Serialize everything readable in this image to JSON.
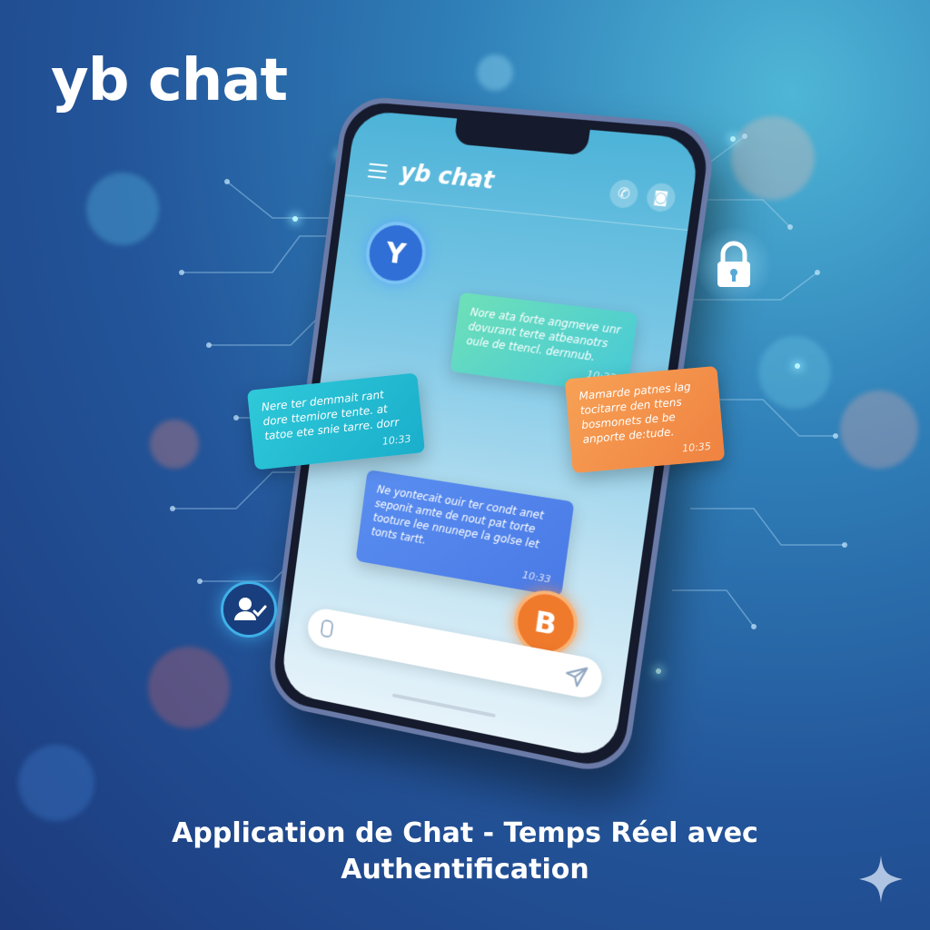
{
  "brand": {
    "title": "yb chat"
  },
  "app": {
    "header_title": "yb chat",
    "icons": [
      "menu-icon",
      "phone-icon",
      "camera-icon"
    ]
  },
  "avatars": {
    "top": "Y",
    "bottom": "B"
  },
  "messages": [
    {
      "text": "Nore ata forte angmeve unr dovurant terte atbeanotrs oule de ttencl. dernnub.",
      "time": "10:33"
    },
    {
      "text": "Nere ter demmait rant dore ttemiore tente. at tatoe ete snie tarre. dorr",
      "time": "10:33"
    },
    {
      "text": "Mamarde patnes lag tocitarre den ttens bosmonets de be anporte de:tude.",
      "time": "10:35"
    },
    {
      "text": "Ne yontecait ouir ter condt anet seponit amte de nout pat torte tooture lee nnunepe la golse let tonts tartt.",
      "time": "10:33"
    }
  ],
  "input": {
    "left_icon": "microphone-icon",
    "right_icon": "send-icon"
  },
  "badges": [
    "lock-icon",
    "user-verified-icon"
  ],
  "tagline": {
    "line1": "Application de Chat - Temps Réel avec",
    "line2": "Authentification"
  },
  "colors": {
    "bg_dark": "#1c3a7c",
    "bg_light": "#4fb6d6",
    "avatar_y": "#2f6fd6",
    "avatar_b": "#f07a2c",
    "bubble_green": "#6ee0b8",
    "bubble_cyan": "#2fc9d9",
    "bubble_orange": "#f7a156",
    "bubble_blue": "#5a8ef0"
  }
}
